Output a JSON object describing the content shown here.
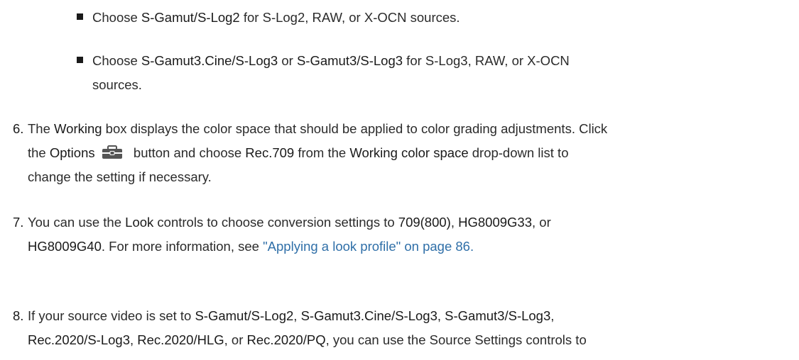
{
  "bullets": [
    {
      "pre": "Choose ",
      "ui1": "S-Gamut/S-Log2",
      "post": " for S-Log2, RAW, or X-OCN sources."
    },
    {
      "pre": "Choose ",
      "ui1": "S-Gamut3.Cine/S-Log3",
      "mid": " or ",
      "ui2": "S-Gamut3/S-Log3",
      "post_line1": " for S-Log3, RAW, or X-OCN",
      "post_line2": "sources."
    }
  ],
  "steps": [
    {
      "number": "6.",
      "t1": "The ",
      "ui_working": "Working",
      "t2": " box displays the color space that should be applied to color grading adjustments. Click",
      "t3": "the ",
      "ui_options": "Options",
      "icon": "toolbox-icon",
      "t4": " button and choose ",
      "ui_rec709": "Rec.709",
      "t5": " from the ",
      "ui_wcs": "Working color space",
      "t6": " drop-down list to",
      "t7": "change the setting if necessary."
    },
    {
      "number": "7.",
      "t1": "You can use the ",
      "ui_look": "Look",
      "t2": " controls to choose conversion settings to ",
      "ui_709": "709(800)",
      "t3": ", ",
      "ui_hg33": "HG8009G33",
      "t4": ", or",
      "ui_hg40": "HG8009G40",
      "t5": ". For more information, see ",
      "link": "\"Applying a look profile\" on page 86."
    },
    {
      "number": "8.",
      "t1": "If your source video is set to ",
      "ui_a": "S-Gamut/S-Log2",
      "s1": ", ",
      "ui_b": "S-Gamut3.Cine/S-Log3",
      "s2": ", ",
      "ui_c": "S-Gamut3/S-Log3",
      "s3": ",",
      "ui_d": "Rec.2020/S-Log3",
      "s4": ", ",
      "ui_e": "Rec.2020/HLG",
      "s5": ", or ",
      "ui_f": "Rec.2020/PQ",
      "t2": ", you can use the Source Settings controls to"
    }
  ]
}
